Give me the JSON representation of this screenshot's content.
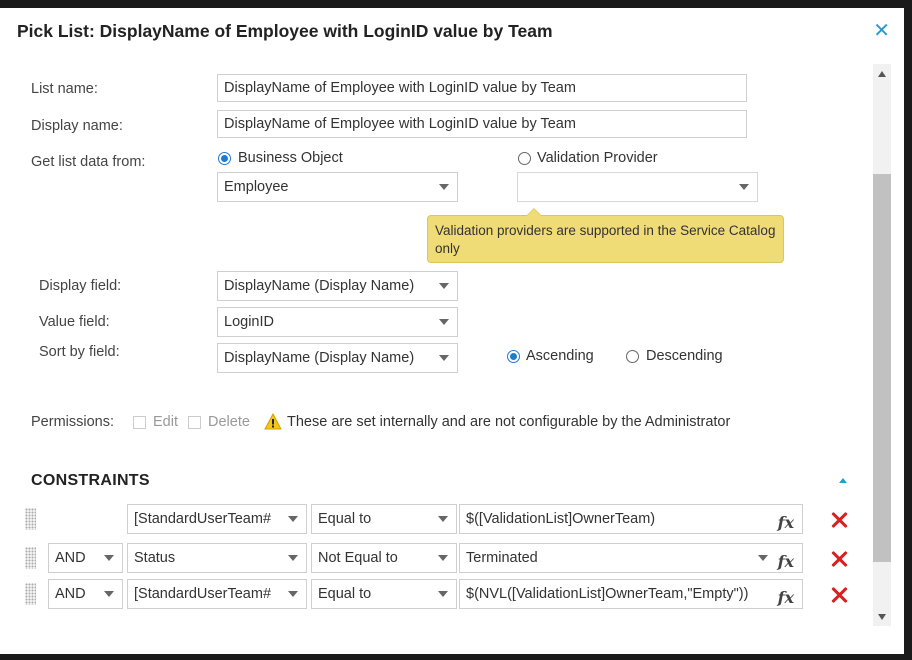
{
  "dialog": {
    "title": "Pick List: DisplayName of Employee with LoginID value by Team",
    "close_icon": "close-icon"
  },
  "form": {
    "list_name": {
      "label": "List name:",
      "value": "DisplayName of Employee with LoginID value by Team"
    },
    "display_name": {
      "label": "Display name:",
      "value": "DisplayName of Employee with LoginID value by Team"
    },
    "get_list_data": {
      "label": "Get list data from:",
      "business_object": {
        "label": "Business Object",
        "selected": true,
        "value": "Employee"
      },
      "validation_provider": {
        "label": "Validation Provider",
        "selected": false,
        "value": ""
      },
      "tooltip": "Validation providers are supported in the Service Catalog only"
    },
    "display_field": {
      "label": "Display field:",
      "value": "DisplayName (Display Name)"
    },
    "value_field": {
      "label": "Value field:",
      "value": "LoginID"
    },
    "sort_by_field": {
      "label": "Sort by field:",
      "value": "DisplayName (Display Name)",
      "ascending": {
        "label": "Ascending",
        "selected": true
      },
      "descending": {
        "label": "Descending",
        "selected": false
      }
    },
    "permissions": {
      "label": "Permissions:",
      "edit": "Edit",
      "delete": "Delete",
      "note": "These are set internally and are not configurable by the Administrator"
    }
  },
  "constraints": {
    "title": "CONSTRAINTS",
    "rows": [
      {
        "conjunction": "",
        "field": "[StandardUserTeam#",
        "operator": "Equal to",
        "value": "$([ValidationList]OwnerTeam)"
      },
      {
        "conjunction": "AND",
        "field": "Status",
        "operator": "Not Equal to",
        "value": "Terminated"
      },
      {
        "conjunction": "AND",
        "field": "[StandardUserTeam#",
        "operator": "Equal to",
        "value": "$(NVL([ValidationList]OwnerTeam,\"Empty\"))"
      }
    ],
    "fx_label": "fx"
  },
  "colors": {
    "accent": "#2c9ad1",
    "radio": "#1f7bd1",
    "tooltip_bg": "#f0dc76",
    "delete": "#d91f1f",
    "warning": "#f5c518"
  }
}
